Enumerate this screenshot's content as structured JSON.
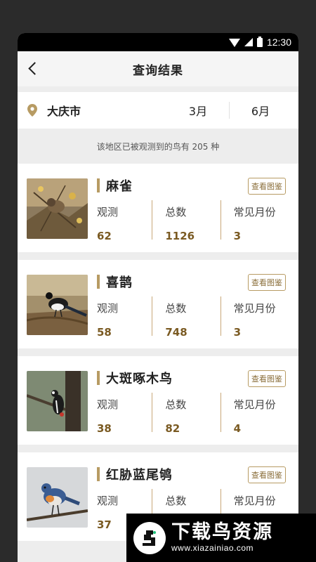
{
  "status_bar": {
    "time": "12:30"
  },
  "header": {
    "title": "查询结果"
  },
  "filter": {
    "city": "大庆市",
    "month_start": "3月",
    "month_end": "6月"
  },
  "summary": "该地区已被观测到的鸟有 205 种",
  "stat_labels": {
    "observed": "观测",
    "total": "总数",
    "common_months": "常见月份"
  },
  "catalog_label": "查看图鉴",
  "birds": [
    {
      "name": "麻雀",
      "observed": "62",
      "total": "1126",
      "common_months": "3"
    },
    {
      "name": "喜鹊",
      "observed": "58",
      "total": "748",
      "common_months": "3"
    },
    {
      "name": "大斑啄木鸟",
      "observed": "38",
      "total": "82",
      "common_months": "4"
    },
    {
      "name": "红胁蓝尾鸲",
      "observed": "37",
      "total": "",
      "common_months": ""
    }
  ],
  "watermark": {
    "title": "下载鸟资源",
    "url": "www.xiazainiao.com"
  },
  "colors": {
    "accent": "#b79b63",
    "value": "#7a5a22"
  }
}
